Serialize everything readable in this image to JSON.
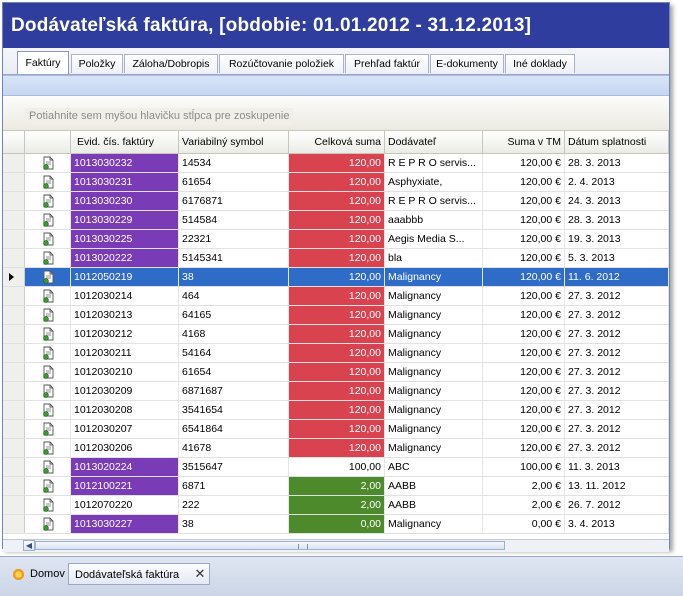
{
  "window": {
    "title": "Dodávateľská faktúra, [obdobie: 01.01.2012 - 31.12.2013]"
  },
  "tabs": [
    {
      "label": "Faktúry",
      "active": true
    },
    {
      "label": "Položky"
    },
    {
      "label": "Záloha/Dobropis"
    },
    {
      "label": "Rozúčtovanie položiek"
    },
    {
      "label": "Prehľad faktúr"
    },
    {
      "label": "E-dokumenty"
    },
    {
      "label": "Iné doklady"
    }
  ],
  "group_panel": {
    "hint": "Potiahnite sem myšou hlavičku stĺpca pre zoskupenie"
  },
  "columns": {
    "id": "Evid. čís. faktúry",
    "var": "Variabilný symbol",
    "sum": "Celková suma",
    "dod": "Dodávateľ",
    "tm": "Suma v TM",
    "date": "Dátum splatnosti"
  },
  "colors": {
    "purple": "#7a3bb7",
    "red": "#d8434f",
    "green": "#4c8a2c",
    "selected": "#2f6cc7"
  },
  "rows": [
    {
      "id": "1013030232",
      "var": "14534",
      "sum": "120,00",
      "dod": "R E P R O servis...",
      "tm": "120,00 €",
      "date": "28. 3. 2013",
      "id_color": "purple",
      "sum_color": "red"
    },
    {
      "id": "1013030231",
      "var": "61654",
      "sum": "120,00",
      "dod": "Asphyxiate,",
      "tm": "120,00 €",
      "date": "2. 4. 2013",
      "id_color": "purple",
      "sum_color": "red"
    },
    {
      "id": "1013030230",
      "var": "6176871",
      "sum": "120,00",
      "dod": "R E P R O servis...",
      "tm": "120,00 €",
      "date": "24. 3. 2013",
      "id_color": "purple",
      "sum_color": "red"
    },
    {
      "id": "1013030229",
      "var": "514584",
      "sum": "120,00",
      "dod": "aaabbb",
      "tm": "120,00 €",
      "date": "28. 3. 2013",
      "id_color": "purple",
      "sum_color": "red"
    },
    {
      "id": "1013030225",
      "var": "22321",
      "sum": "120,00",
      "dod": "Aegis Media S...",
      "tm": "120,00 €",
      "date": "19. 3. 2013",
      "id_color": "purple",
      "sum_color": "red"
    },
    {
      "id": "1013020222",
      "var": "5145341",
      "sum": "120,00",
      "dod": "bla",
      "tm": "120,00 €",
      "date": "5. 3. 2013",
      "id_color": "purple",
      "sum_color": "red"
    },
    {
      "id": "1012050219",
      "var": "38",
      "sum": "120,00",
      "dod": "Malignancy",
      "tm": "120,00 €",
      "date": "11. 6. 2012",
      "id_color": "none",
      "sum_color": "none",
      "selected": true
    },
    {
      "id": "1012030214",
      "var": "464",
      "sum": "120,00",
      "dod": "Malignancy",
      "tm": "120,00 €",
      "date": "27. 3. 2012",
      "id_color": "none",
      "sum_color": "red"
    },
    {
      "id": "1012030213",
      "var": "64165",
      "sum": "120,00",
      "dod": "Malignancy",
      "tm": "120,00 €",
      "date": "27. 3. 2012",
      "id_color": "none",
      "sum_color": "red"
    },
    {
      "id": "1012030212",
      "var": "4168",
      "sum": "120,00",
      "dod": "Malignancy",
      "tm": "120,00 €",
      "date": "27. 3. 2012",
      "id_color": "none",
      "sum_color": "red"
    },
    {
      "id": "1012030211",
      "var": "54164",
      "sum": "120,00",
      "dod": "Malignancy",
      "tm": "120,00 €",
      "date": "27. 3. 2012",
      "id_color": "none",
      "sum_color": "red"
    },
    {
      "id": "1012030210",
      "var": "61654",
      "sum": "120,00",
      "dod": "Malignancy",
      "tm": "120,00 €",
      "date": "27. 3. 2012",
      "id_color": "none",
      "sum_color": "red"
    },
    {
      "id": "1012030209",
      "var": "6871687",
      "sum": "120,00",
      "dod": "Malignancy",
      "tm": "120,00 €",
      "date": "27. 3. 2012",
      "id_color": "none",
      "sum_color": "red"
    },
    {
      "id": "1012030208",
      "var": "3541654",
      "sum": "120,00",
      "dod": "Malignancy",
      "tm": "120,00 €",
      "date": "27. 3. 2012",
      "id_color": "none",
      "sum_color": "red"
    },
    {
      "id": "1012030207",
      "var": "6541864",
      "sum": "120,00",
      "dod": "Malignancy",
      "tm": "120,00 €",
      "date": "27. 3. 2012",
      "id_color": "none",
      "sum_color": "red"
    },
    {
      "id": "1012030206",
      "var": "41678",
      "sum": "120,00",
      "dod": "Malignancy",
      "tm": "120,00 €",
      "date": "27. 3. 2012",
      "id_color": "none",
      "sum_color": "red"
    },
    {
      "id": "1013020224",
      "var": "3515647",
      "sum": "100,00",
      "dod": "ABC",
      "tm": "100,00 €",
      "date": "11. 3. 2013",
      "id_color": "purple",
      "sum_color": "none"
    },
    {
      "id": "1012100221",
      "var": "6871",
      "sum": "2,00",
      "dod": "AABB",
      "tm": "2,00 €",
      "date": "13. 11. 2012",
      "id_color": "purple",
      "sum_color": "green"
    },
    {
      "id": "1012070220",
      "var": "222",
      "sum": "2,00",
      "dod": "AABB",
      "tm": "2,00 €",
      "date": "26. 7. 2012",
      "id_color": "none",
      "sum_color": "green"
    },
    {
      "id": "1013030227",
      "var": "38",
      "sum": "0,00",
      "dod": "Malignancy",
      "tm": "0,00 €",
      "date": "3. 4. 2013",
      "id_color": "purple",
      "sum_color": "green"
    }
  ],
  "bottom_tabs": {
    "home": "Domov",
    "document": "Dodávateľská faktúra",
    "close_symbol": "✕"
  }
}
